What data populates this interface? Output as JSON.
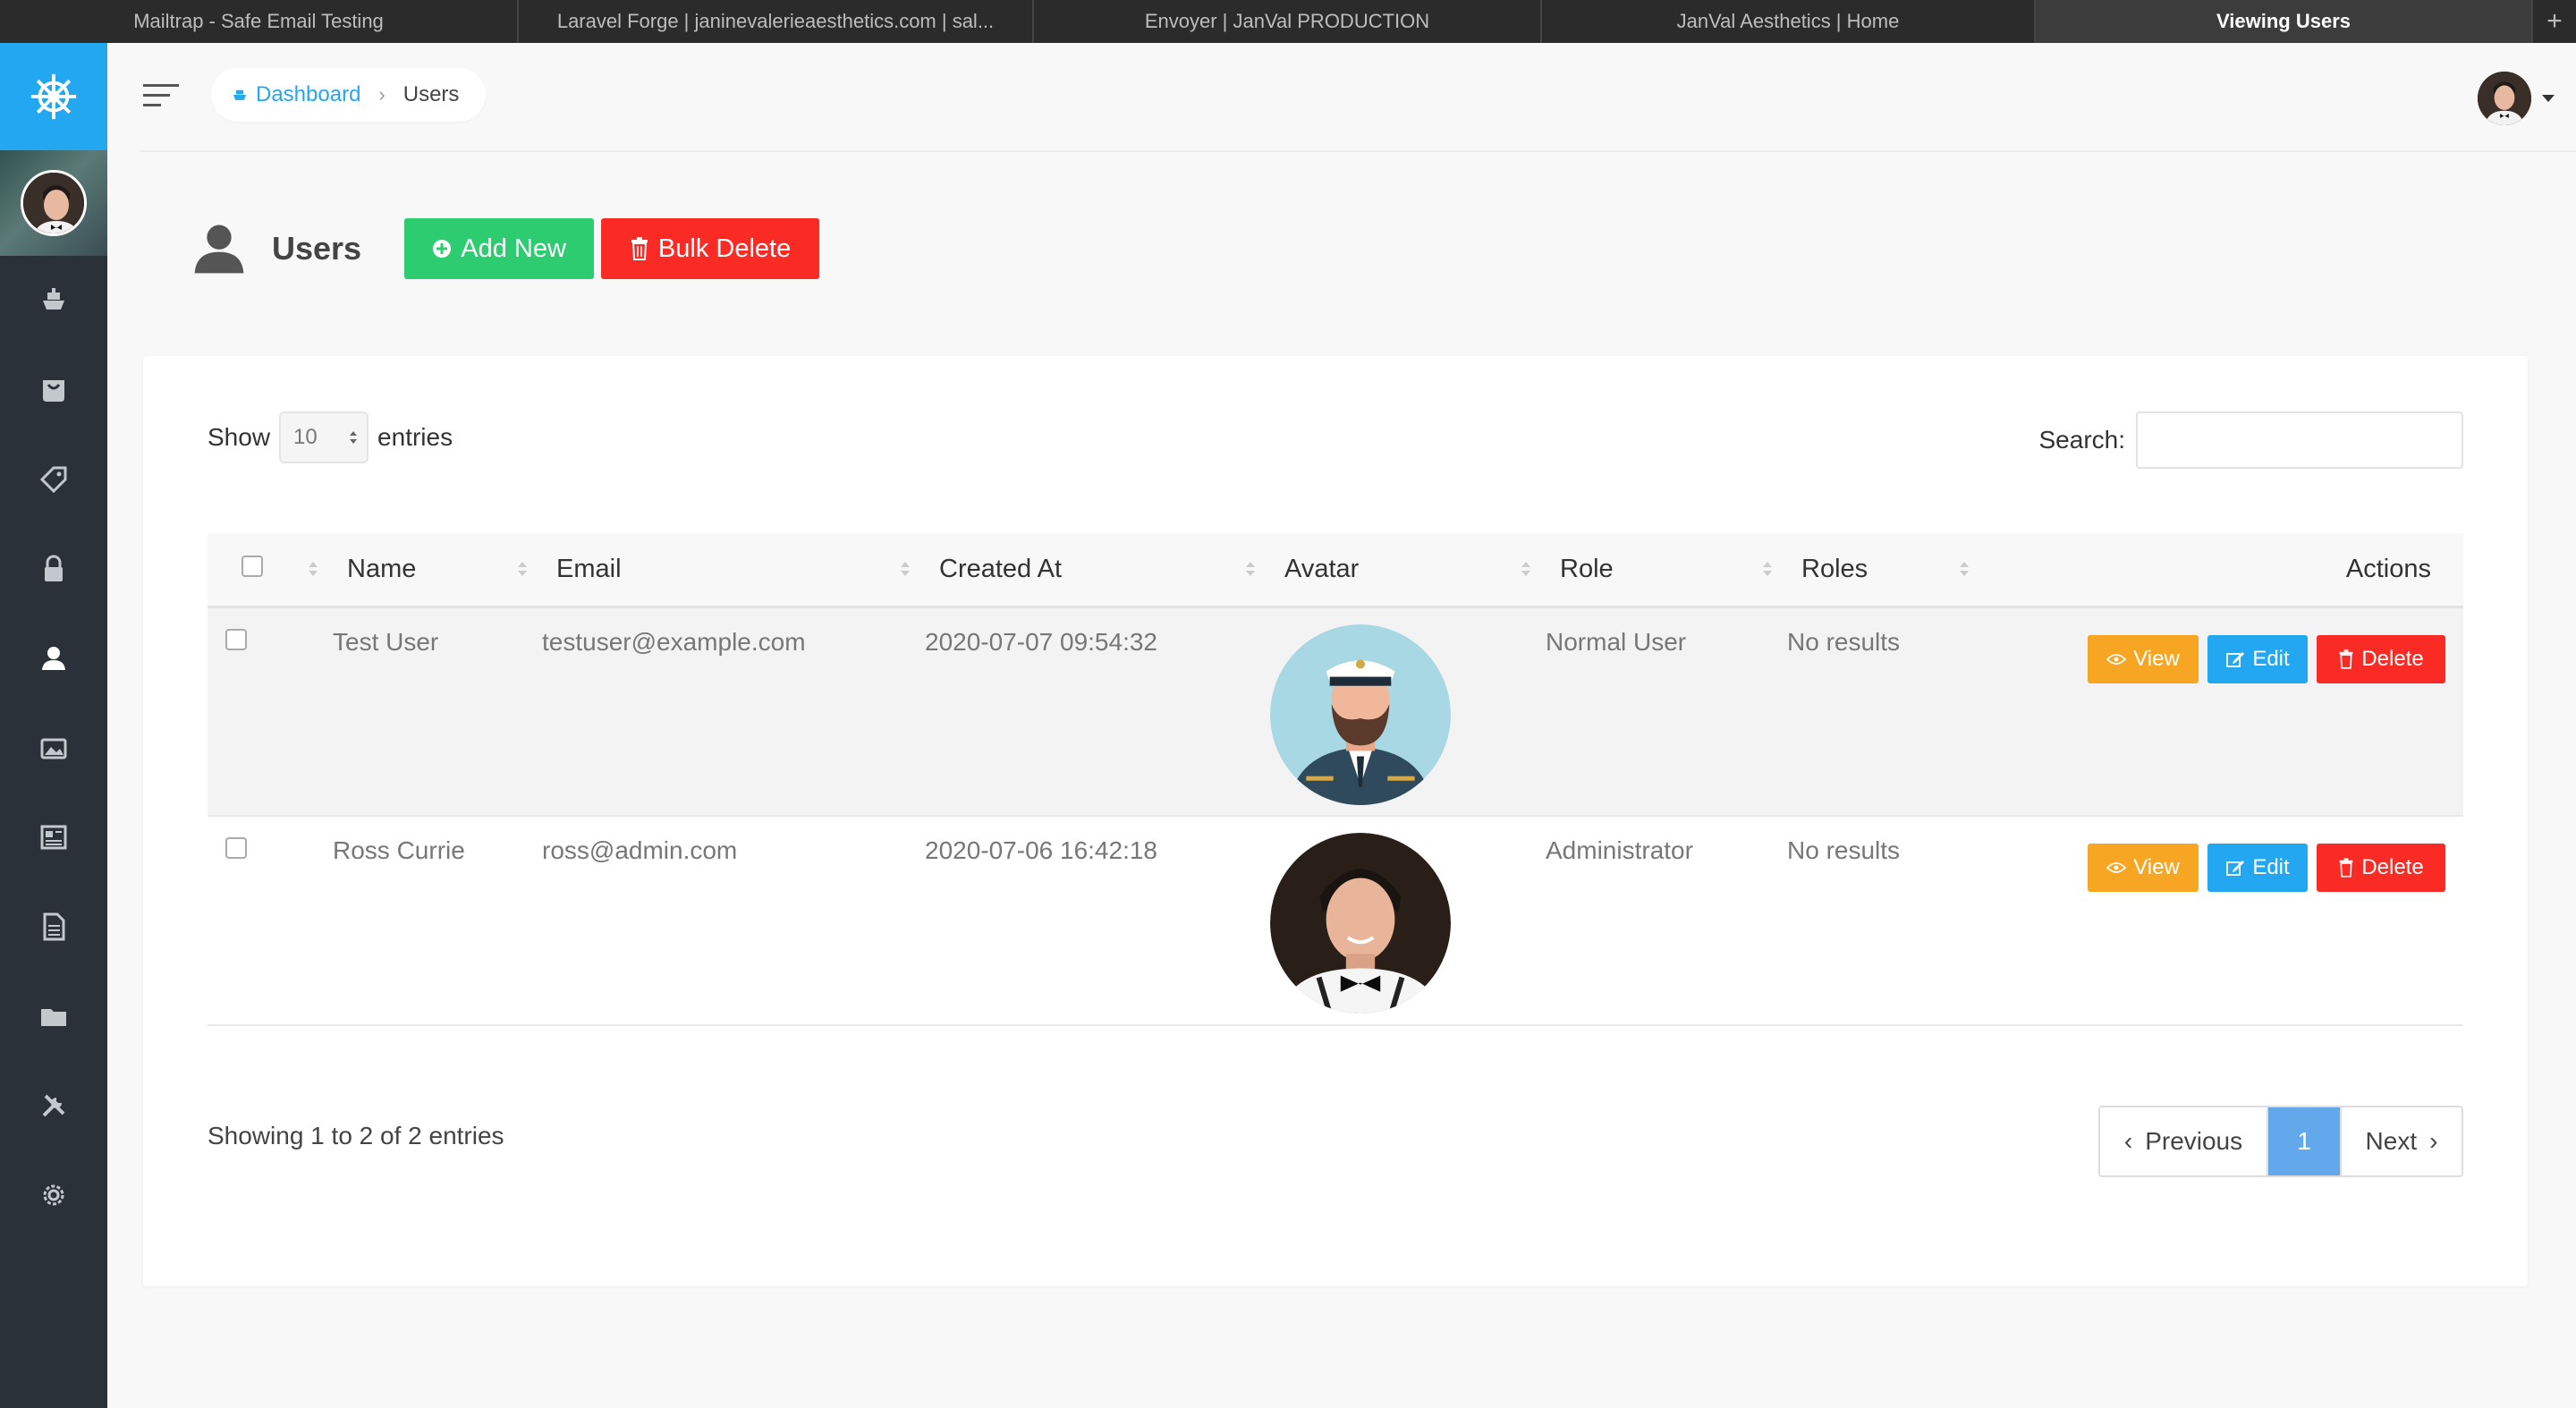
{
  "browser": {
    "tabs": [
      {
        "title": "Mailtrap - Safe Email Testing",
        "active": false
      },
      {
        "title": "Laravel Forge | janinevalerieaesthetics.com | sal...",
        "active": false
      },
      {
        "title": "Envoyer | JanVal PRODUCTION",
        "active": false
      },
      {
        "title": "JanVal Aesthetics | Home",
        "active": false
      },
      {
        "title": "Viewing Users",
        "active": true
      }
    ],
    "new_tab_symbol": "+"
  },
  "sidebar": {
    "brand_icon": "ship-wheel-icon",
    "accent_color": "#22a7f0",
    "items": [
      {
        "name": "dashboard",
        "icon": "ship-icon"
      },
      {
        "name": "media",
        "icon": "bag-icon"
      },
      {
        "name": "tags",
        "icon": "tag-icon"
      },
      {
        "name": "roles",
        "icon": "lock-icon"
      },
      {
        "name": "users",
        "icon": "person-icon",
        "active": true
      },
      {
        "name": "gallery",
        "icon": "images-icon"
      },
      {
        "name": "posts",
        "icon": "news-icon"
      },
      {
        "name": "pages",
        "icon": "document-icon"
      },
      {
        "name": "categories",
        "icon": "folder-icon"
      },
      {
        "name": "tools",
        "icon": "tools-icon"
      },
      {
        "name": "settings",
        "icon": "gear-icon"
      }
    ]
  },
  "topnav": {
    "breadcrumb": {
      "home": "Dashboard",
      "current": "Users"
    }
  },
  "header": {
    "title": "Users",
    "add_label": "Add New",
    "bulk_delete_label": "Bulk Delete"
  },
  "table_controls": {
    "show_label": "Show",
    "page_length": "10",
    "entries_label": "entries",
    "search_label": "Search:",
    "search_value": ""
  },
  "table": {
    "columns": [
      "Name",
      "Email",
      "Created At",
      "Avatar",
      "Role",
      "Roles",
      "Actions"
    ],
    "rows": [
      {
        "name": "Test User",
        "email": "testuser@example.com",
        "created_at": "2020-07-07 09:54:32",
        "avatar": "captain-avatar",
        "role": "Normal User",
        "roles": "No results"
      },
      {
        "name": "Ross Currie",
        "email": "ross@admin.com",
        "created_at": "2020-07-06 16:42:18",
        "avatar": "photo-avatar",
        "role": "Administrator",
        "roles": "No results"
      }
    ],
    "actions": {
      "view": "View",
      "edit": "Edit",
      "delete": "Delete"
    }
  },
  "footer": {
    "info": "Showing 1 to 2 of 2 entries",
    "previous": "Previous",
    "current_page": "1",
    "next": "Next"
  },
  "colors": {
    "green": "#2ecc71",
    "red": "#fa2a24",
    "orange": "#f6a623",
    "blue": "#22a7f0",
    "page_active": "#62a8ea"
  }
}
